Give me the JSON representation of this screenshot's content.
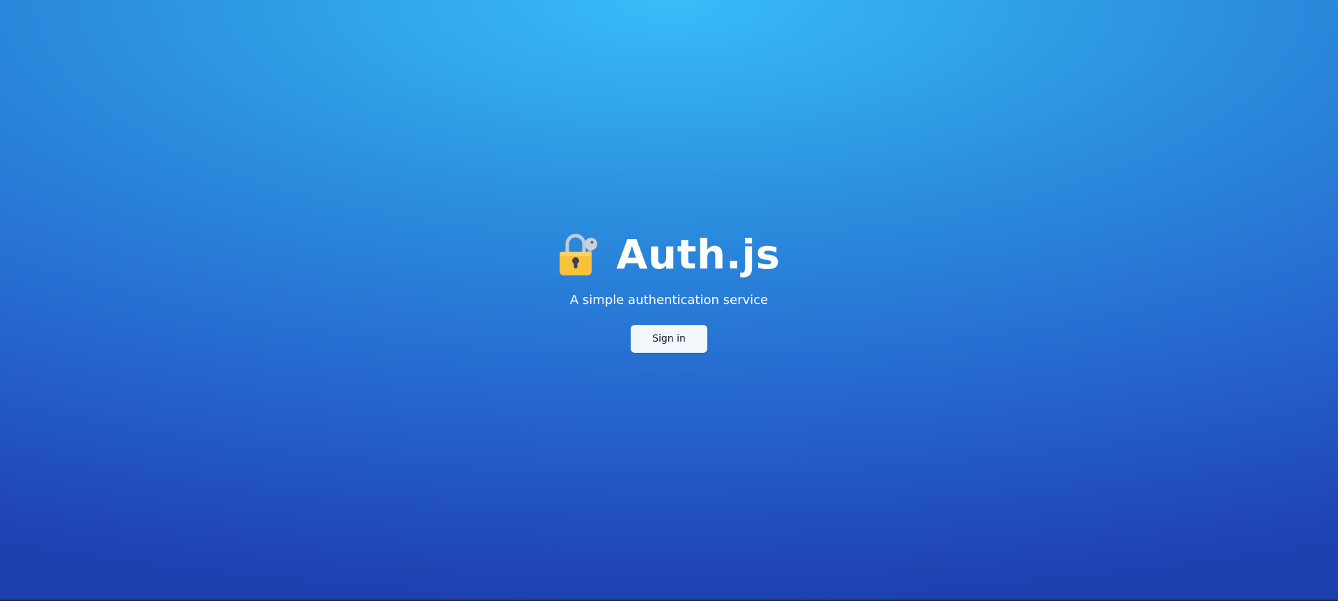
{
  "hero": {
    "icon": "lock-with-key-icon",
    "title": "Auth.js",
    "subtitle": "A simple authentication service",
    "signin_label": "Sign in"
  },
  "colors": {
    "gradient_top": "#38bdf8",
    "gradient_bottom": "#1e40af",
    "lock_body": "#f8c23a",
    "button_bg": "#f3f6fa"
  }
}
